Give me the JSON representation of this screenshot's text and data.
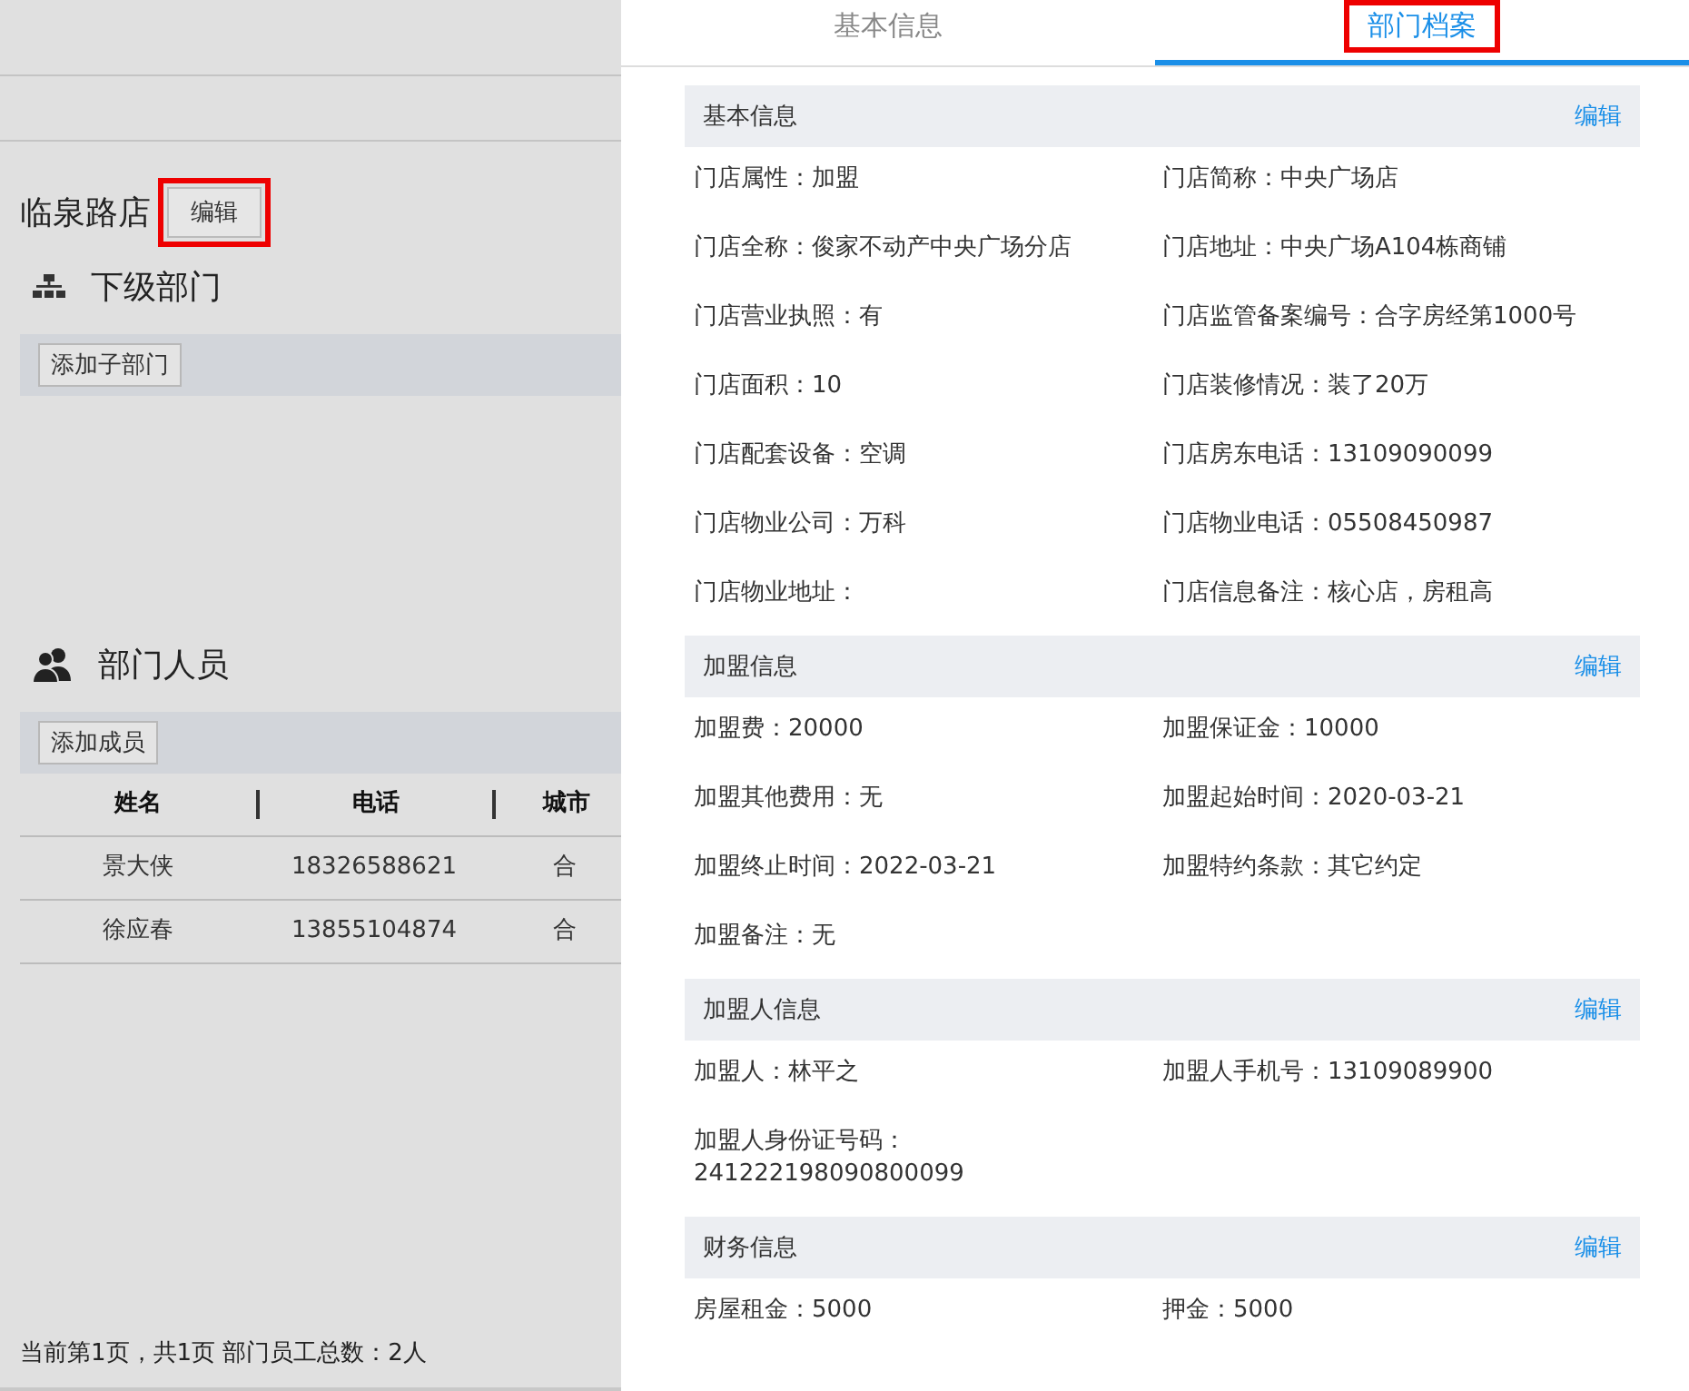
{
  "store": {
    "name": "临泉路店",
    "edit_button": {
      "label": "编辑",
      "highlighted": true
    }
  },
  "sub_departments": {
    "title": "下级部门",
    "add_button": "添加子部门"
  },
  "members": {
    "title": "部门人员",
    "add_button": "添加成员",
    "columns": [
      "姓名",
      "电话",
      "城市"
    ],
    "rows": [
      [
        "景大侠",
        "18326588621",
        "合"
      ],
      [
        "徐应春",
        "13855104874",
        "合"
      ]
    ]
  },
  "footer": "当前第1页，共1页 部门员工总数：2人",
  "tabs": [
    {
      "label": "基本信息",
      "selected": false,
      "highlighted": false
    },
    {
      "label": "部门档案",
      "selected": true,
      "highlighted": true
    }
  ],
  "sections": [
    {
      "title": "基本信息",
      "edit": "编辑",
      "fields": [
        "门店属性：加盟",
        "门店简称：中央广场店",
        "门店全称：俊家不动产中央广场分店",
        "门店地址：中央广场A104栋商铺",
        "门店营业执照：有",
        "门店监管备案编号：合字房经第1000号",
        "门店面积：10",
        "门店装修情况：装了20万",
        "门店配套设备：空调",
        "门店房东电话：13109090099",
        "门店物业公司：万科",
        "门店物业电话：05508450987",
        "门店物业地址：",
        "门店信息备注：核心店，房租高"
      ]
    },
    {
      "title": "加盟信息",
      "edit": "编辑",
      "fields": [
        "加盟费：20000",
        "加盟保证金：10000",
        "加盟其他费用：无",
        "加盟起始时间：2020-03-21",
        "加盟终止时间：2022-03-21",
        "加盟特约条款：其它约定",
        "加盟备注：无"
      ]
    },
    {
      "title": "加盟人信息",
      "edit": "编辑",
      "fields": [
        "加盟人：林平之",
        "加盟人手机号：13109089900",
        "加盟人身份证号码：241222198090800099"
      ]
    },
    {
      "title": "财务信息",
      "edit": "编辑",
      "fields": [
        "房屋租金：5000",
        "押金：5000"
      ]
    }
  ]
}
